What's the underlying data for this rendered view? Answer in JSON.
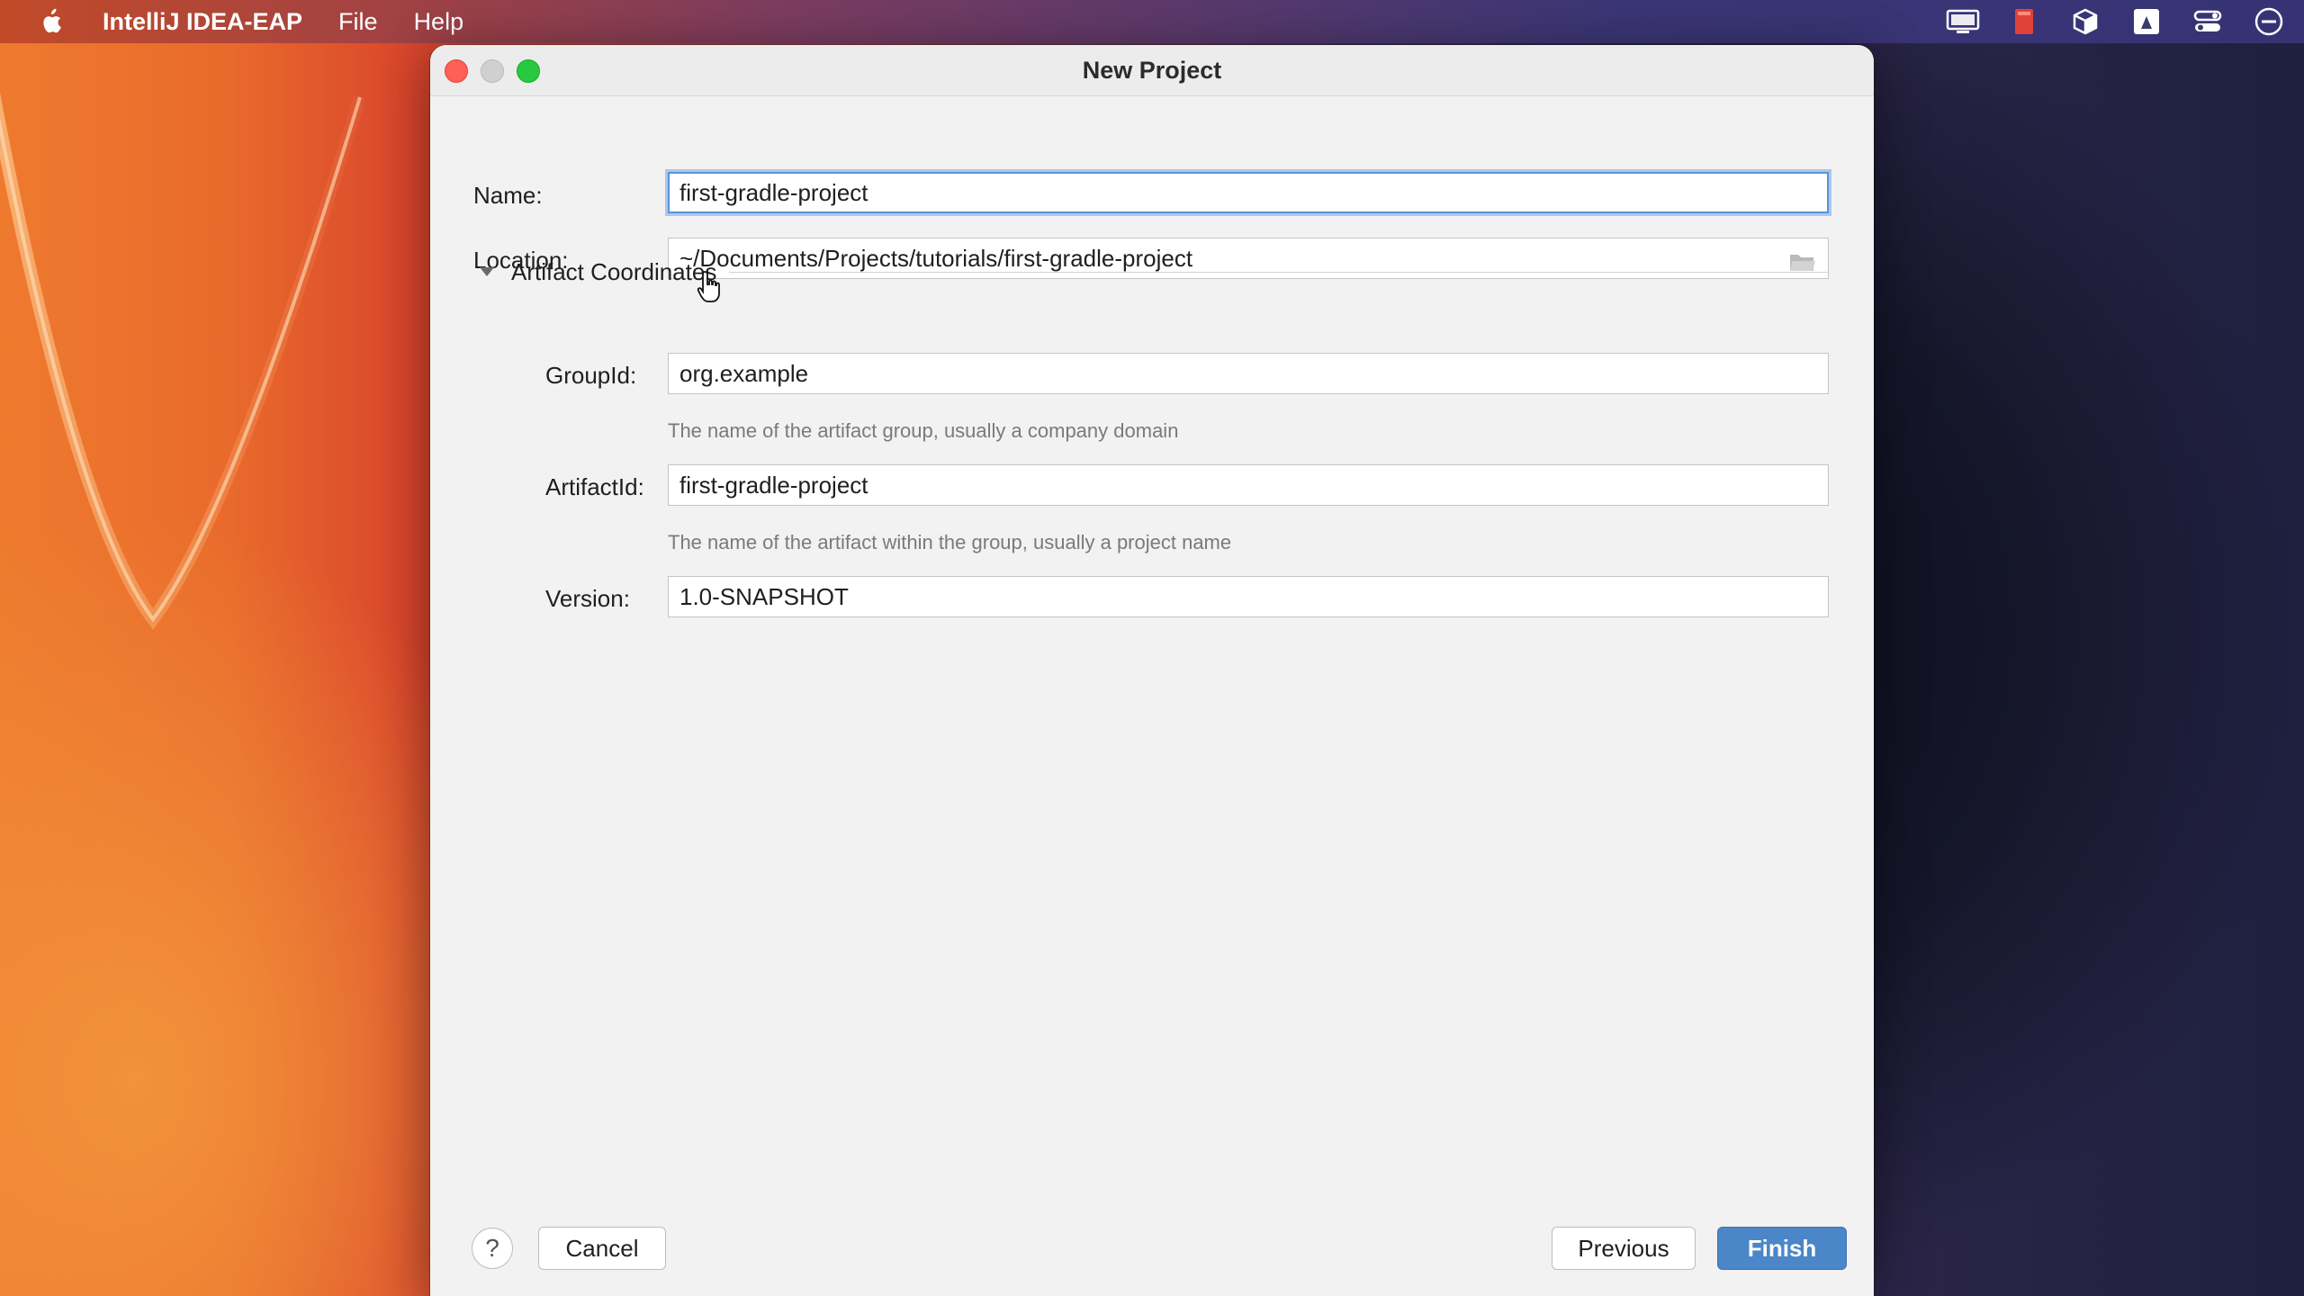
{
  "menubar": {
    "app_name": "IntelliJ IDEA-EAP",
    "menus": [
      "File",
      "Help"
    ],
    "status_icons": [
      "display-icon",
      "red-app-icon",
      "cube-icon",
      "drive-icon",
      "control-center-icon",
      "minus-circle-icon"
    ]
  },
  "dialog": {
    "title": "New Project",
    "name_label": "Name:",
    "name_value": "first-gradle-project",
    "location_label": "Location:",
    "location_value": "~/Documents/Projects/tutorials/first-gradle-project",
    "section_title": "Artifact Coordinates",
    "groupid_label": "GroupId:",
    "groupid_value": "org.example",
    "groupid_hint": "The name of the artifact group, usually a company domain",
    "artifactid_label": "ArtifactId:",
    "artifactid_value": "first-gradle-project",
    "artifactid_hint": "The name of the artifact within the group, usually a project name",
    "version_label": "Version:",
    "version_value": "1.0-SNAPSHOT"
  },
  "buttons": {
    "help": "?",
    "cancel": "Cancel",
    "previous": "Previous",
    "finish": "Finish"
  },
  "colors": {
    "accent": "#4a86c8",
    "focus_ring": "#a9c8ee"
  }
}
